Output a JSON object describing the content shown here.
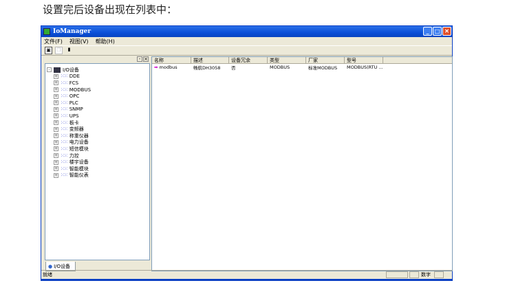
{
  "caption": "设置完后设备出现在列表中：",
  "window": {
    "title": "IoManager"
  },
  "menu": [
    "文件(F)",
    "视图(V)",
    "帮助(H)"
  ],
  "tree": {
    "root": "I/O设备",
    "children": [
      "DDE",
      "FCS",
      "MODBUS",
      "OPC",
      "PLC",
      "SNMP",
      "UPS",
      "板卡",
      "变频器",
      "称重仪器",
      "电力设备",
      "短信模块",
      "力控",
      "楼宇设备",
      "智能模块",
      "智能仪表"
    ]
  },
  "left_tab": "I/O设备",
  "columns": [
    "名称",
    "描述",
    "设备冗余",
    "类型",
    "厂家",
    "型号"
  ],
  "rows": [
    [
      "modbus",
      "畅航DH3058",
      "否",
      "MODBUS",
      "标准MODBUS",
      "MODBUS(RTU ..."
    ]
  ],
  "status": {
    "ready": "就绪",
    "numlock": "数字"
  }
}
